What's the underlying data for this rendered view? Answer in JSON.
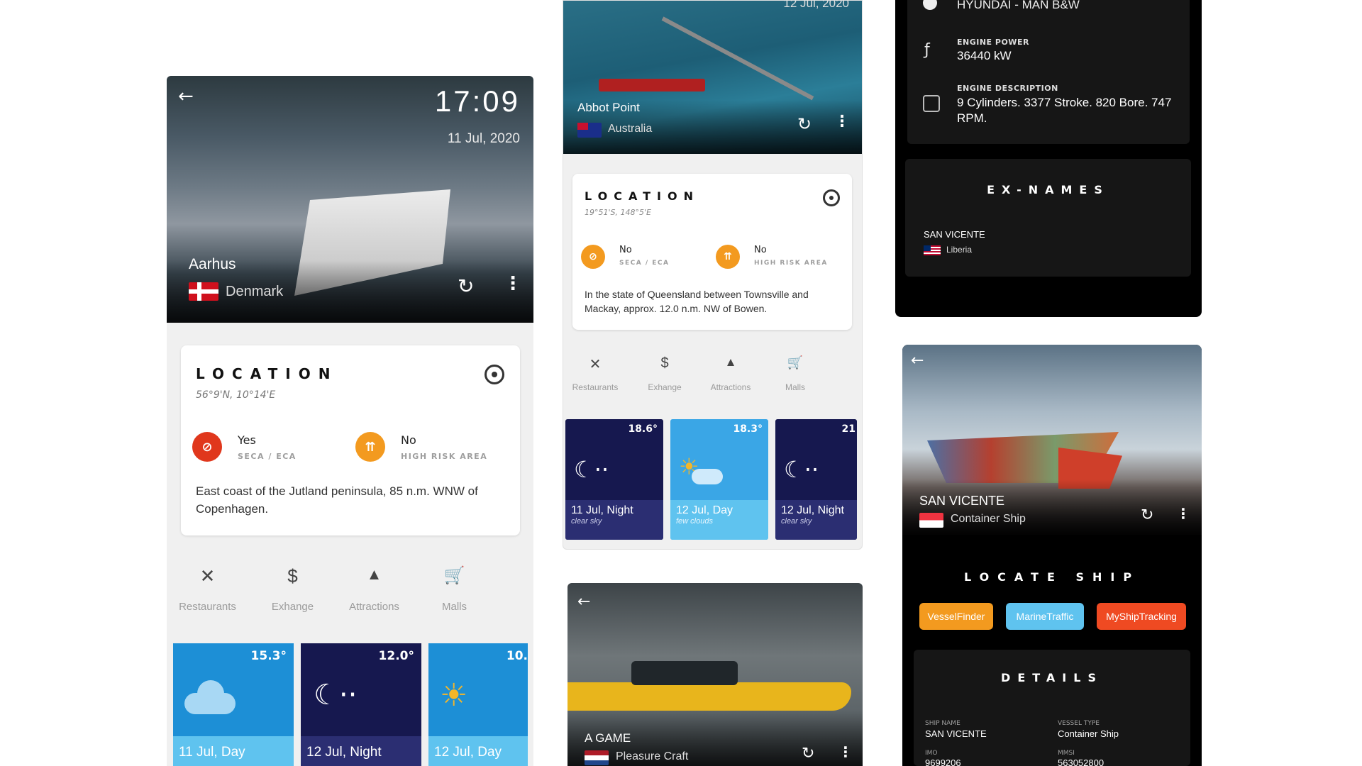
{
  "screen1": {
    "time": "17:09",
    "date": "11 Jul, 2020",
    "port": "Aarhus",
    "country": "Denmark",
    "location_title": "LOCATION",
    "coords": "56°9'N, 10°14'E",
    "seca_value": "Yes",
    "seca_label": "SECA / ECA",
    "risk_value": "No",
    "risk_label": "HIGH RISK AREA",
    "description": "East coast of the Jutland peninsula, 85 n.m. WNW of Copenhagen.",
    "categories": [
      "Restaurants",
      "Exhange",
      "Attractions",
      "Malls"
    ],
    "weather": [
      {
        "temp": "15.3°",
        "label": "11 Jul, Day"
      },
      {
        "temp": "12.0°",
        "label": "12 Jul, Night"
      },
      {
        "temp": "10.",
        "label": "12 Jul, Day"
      }
    ]
  },
  "screen2": {
    "date": "12 Jul, 2020",
    "port": "Abbot Point",
    "country": "Australia",
    "location_title": "LOCATION",
    "coords": "19°51'S, 148°5'E",
    "seca_value": "No",
    "seca_label": "SECA / ECA",
    "risk_value": "No",
    "risk_label": "HIGH RISK AREA",
    "description": "In the state of Queensland between Townsville and Mackay, approx. 12.0 n.m. NW of Bowen.",
    "categories": [
      "Restaurants",
      "Exhange",
      "Attractions",
      "Malls"
    ],
    "weather": [
      {
        "temp": "18.6°",
        "label": "11 Jul, Night",
        "desc": "clear sky"
      },
      {
        "temp": "18.3°",
        "label": "12 Jul, Day",
        "desc": "few clouds"
      },
      {
        "temp": "21",
        "label": "12 Jul, Night",
        "desc": "clear sky"
      }
    ]
  },
  "screen3": {
    "vessel_name": "A GAME",
    "vessel_type": "Pleasure Craft"
  },
  "screen4": {
    "engine_builder": "HYUNDAI - MAN B&W",
    "engine_power_label": "ENGINE POWER",
    "engine_power": "36440 kW",
    "engine_desc_label": "ENGINE DESCRIPTION",
    "engine_desc": "9 Cylinders. 3377 Stroke. 820 Bore. 747 RPM.",
    "exnames_title": "EX-NAMES",
    "exname": "SAN VICENTE",
    "exname_flag": "Liberia"
  },
  "screen5": {
    "vessel_name": "SAN VICENTE",
    "vessel_type": "Container Ship",
    "locate_title": "LOCATE SHIP",
    "buttons": [
      "VesselFinder",
      "MarineTraffic",
      "MyShipTracking"
    ],
    "details_title": "DETAILS",
    "ship_name_label": "SHIP NAME",
    "ship_name": "SAN VICENTE",
    "vessel_type_label": "VESSEL TYPE",
    "vessel_type_value": "Container Ship",
    "imo_label": "IMO",
    "imo": "9699206",
    "mmsi_label": "MMSI",
    "mmsi": "563052800"
  },
  "colors": {
    "orange": "#f39a1f",
    "red": "#e0371c",
    "blue_day": "#1d8fd6",
    "navy_night": "#16184f",
    "light_blue": "#5fc3ef"
  }
}
